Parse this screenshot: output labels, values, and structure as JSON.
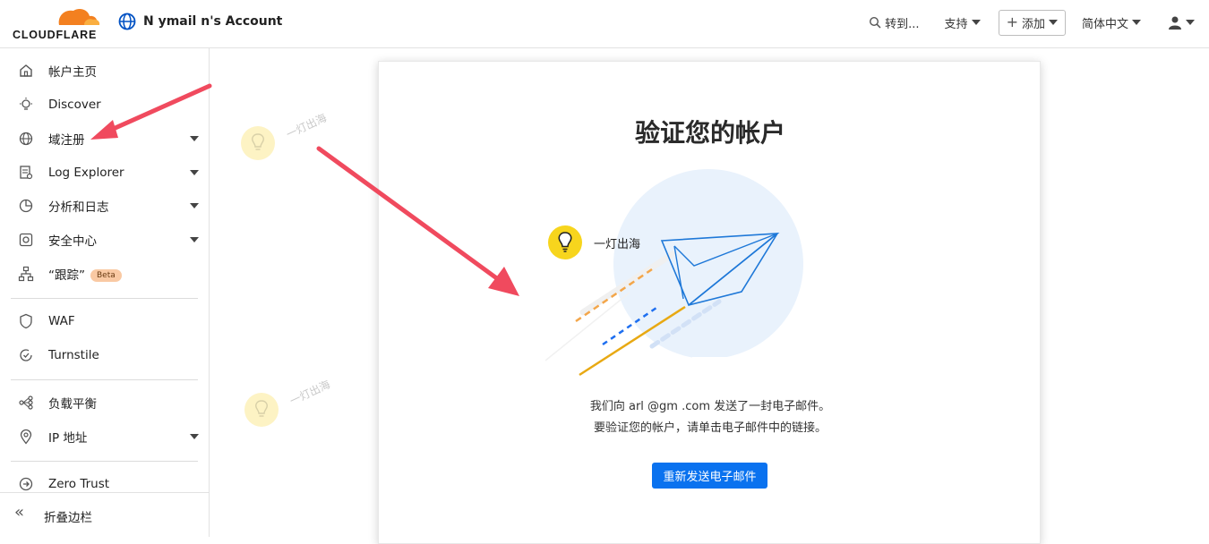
{
  "header": {
    "logo_text": "CLOUDFLARE",
    "account_name": "N         ymail     n's Account",
    "goto_label": "转到...",
    "support_label": "支持",
    "add_label": "添加",
    "language_label": "简体中文"
  },
  "sidebar": {
    "items": [
      {
        "label": "帐户主页"
      },
      {
        "label": "Discover"
      },
      {
        "label": "域注册"
      },
      {
        "label": "Log Explorer"
      },
      {
        "label": "分析和日志"
      },
      {
        "label": "安全中心"
      },
      {
        "label": "“跟踪”"
      },
      {
        "label": "WAF"
      },
      {
        "label": "Turnstile"
      },
      {
        "label": "负载平衡"
      },
      {
        "label": "IP 地址"
      },
      {
        "label": "Zero Trust"
      }
    ],
    "beta_badge": "Beta",
    "collapse_label": "折叠边栏"
  },
  "card": {
    "title": "验证您的帐户",
    "brand_label": "一灯出海",
    "message_line1": "我们向  arl      @gm  .com 发送了一封电子邮件。",
    "message_line2": "要验证您的帐户，请单击电子邮件中的链接。",
    "resend_button": "重新发送电子邮件"
  },
  "watermark": {
    "text": "一灯出海"
  },
  "colors": {
    "accent": "#0a72ef",
    "cloudflare_orange": "#f38020",
    "arrow_red": "#f04a5e",
    "illustration_circle": "#e9f2fc"
  }
}
